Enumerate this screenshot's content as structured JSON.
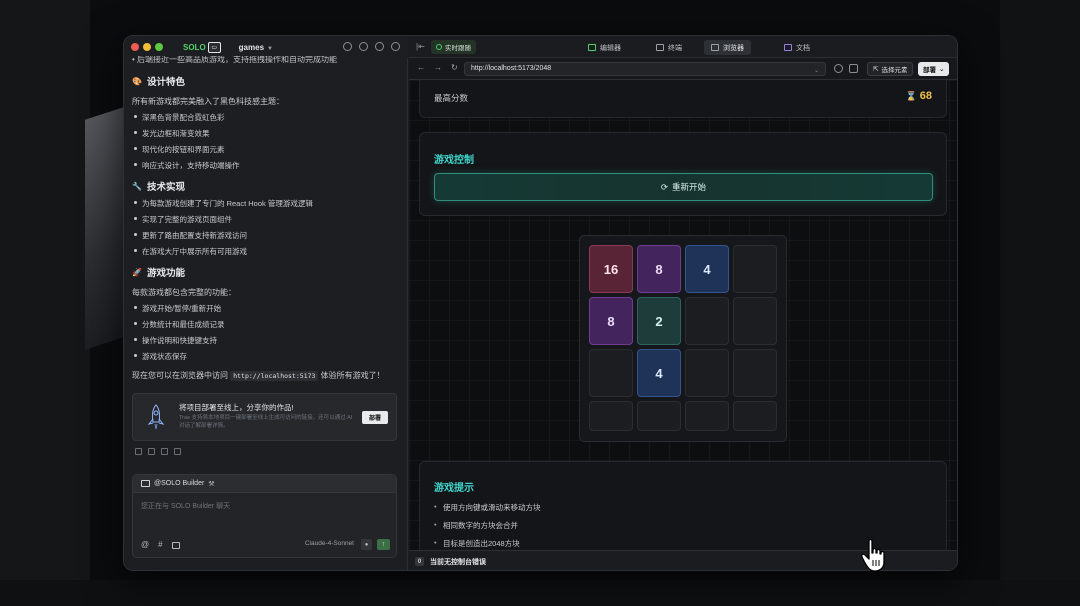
{
  "left_panel": {
    "solo_label": "SOLO",
    "project": "games",
    "cut_line": "后端接近一些高品质游戏，支持拖拽操作和自动完成功能",
    "section_design": {
      "title": "设计特色",
      "emoji": "🎨"
    },
    "design_intro": "所有新游戏都完美融入了黑色科技感主题：",
    "design_items": [
      "深黑色背景配合霓虹色彩",
      "发光边框和渐变效果",
      "现代化的按钮和界面元素",
      "响应式设计，支持移动端操作"
    ],
    "section_tech": {
      "title": "技术实现",
      "emoji": "🔧"
    },
    "tech_items": [
      "为每款游戏创建了专门的 React Hook 管理游戏逻辑",
      "实现了完整的游戏页面组件",
      "更新了路由配置支持新游戏访问",
      "在游戏大厅中展示所有可用游戏"
    ],
    "section_features": {
      "title": "游戏功能",
      "emoji": "🚀"
    },
    "features_intro": "每款游戏都包含完整的功能：",
    "feature_items": [
      "游戏开始/暂停/重新开始",
      "分数统计和最佳成绩记录",
      "操作说明和快捷键支持",
      "游戏状态保存"
    ],
    "closing_pre": "现在您可以在浏览器中访问",
    "closing_code": "http://localhost:5173",
    "closing_post": "体验所有游戏了！",
    "deploy_card": {
      "title": "将项目部署至线上，分享你的作品!",
      "subtitle": "Trae 支持将本地项目一键部署至线上生成可访问的链接，还可以通过 AI 对话了解部署详情。",
      "button": "部署"
    },
    "input": {
      "mention": "@SOLO Builder",
      "placeholder": "您正在与 SOLO Builder 聊天",
      "foot_icons": [
        "@",
        "#"
      ],
      "model": "Claude-4-Sonnet"
    }
  },
  "right_panel": {
    "follow_label": "实时跟随",
    "tabs": [
      {
        "label": "编辑器",
        "active": false
      },
      {
        "label": "终端",
        "active": false
      },
      {
        "label": "浏览器",
        "active": true
      },
      {
        "label": "文档",
        "active": false
      }
    ],
    "url": "http://localhost:5173/2048",
    "pick_label": "选择元素",
    "deploy_label": "部署",
    "best_label": "最高分数",
    "best_value": "68",
    "control_title": "游戏控制",
    "restart_label": "重新开始",
    "board": [
      [
        "16",
        "8",
        "4",
        ""
      ],
      [
        "8",
        "2",
        "",
        ""
      ],
      [
        "",
        "4",
        "",
        ""
      ],
      [
        "",
        "",
        "",
        ""
      ]
    ],
    "tips_title": "游戏提示",
    "tips": [
      "使用方向键或滑动来移动方块",
      "相同数字的方块会合并",
      "目标是创造出2048方块"
    ],
    "console_count": "0",
    "console_text": "当前无控制台错误"
  },
  "colors": {
    "accent_teal": "#3fd3c9",
    "best_gold": "#f1c049",
    "tile_16": "#5a2437",
    "tile_8": "#44245c",
    "tile_4": "#1f3358",
    "tile_2": "#1d3c3a"
  }
}
